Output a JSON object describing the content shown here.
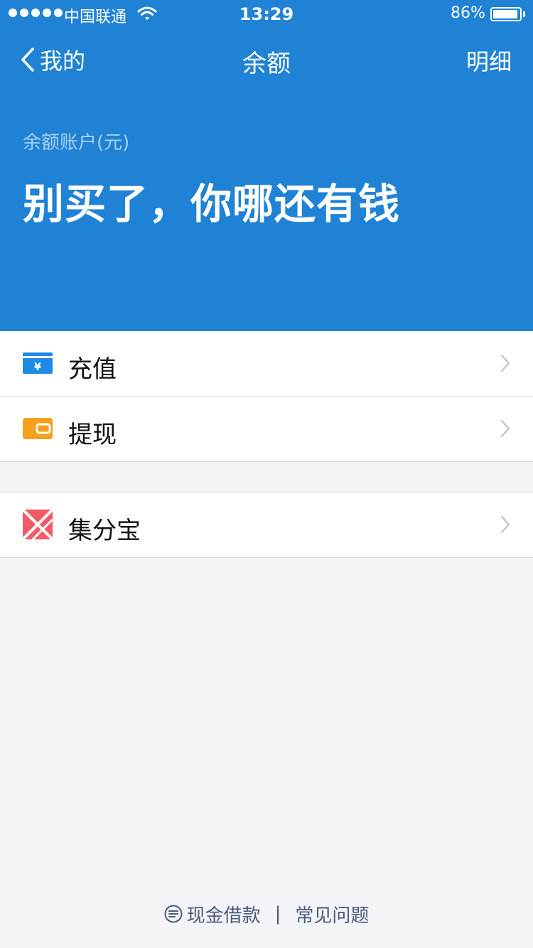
{
  "status_bar": {
    "carrier": "中国联通",
    "time": "13:29",
    "battery": "86%"
  },
  "nav": {
    "back_label": "我的",
    "title": "余额",
    "detail_label": "明细"
  },
  "balance": {
    "label": "余额账户(元)",
    "value": "别买了，你哪还有钱"
  },
  "menu_group_1": [
    {
      "label": "充值",
      "icon": "recharge-icon",
      "color": "#1f8ae6"
    },
    {
      "label": "提现",
      "icon": "wallet-icon",
      "color": "#f4a01a"
    }
  ],
  "menu_group_2": [
    {
      "label": "集分宝",
      "icon": "jifenbao-icon",
      "color": "#f25a67"
    }
  ],
  "footer": {
    "loan_label": "现金借款",
    "separator": "|",
    "faq_label": "常见问题"
  },
  "colors": {
    "header": "#1f82d4",
    "page_background": "#f3f3f8",
    "footer_text": "#4a5a7a"
  }
}
